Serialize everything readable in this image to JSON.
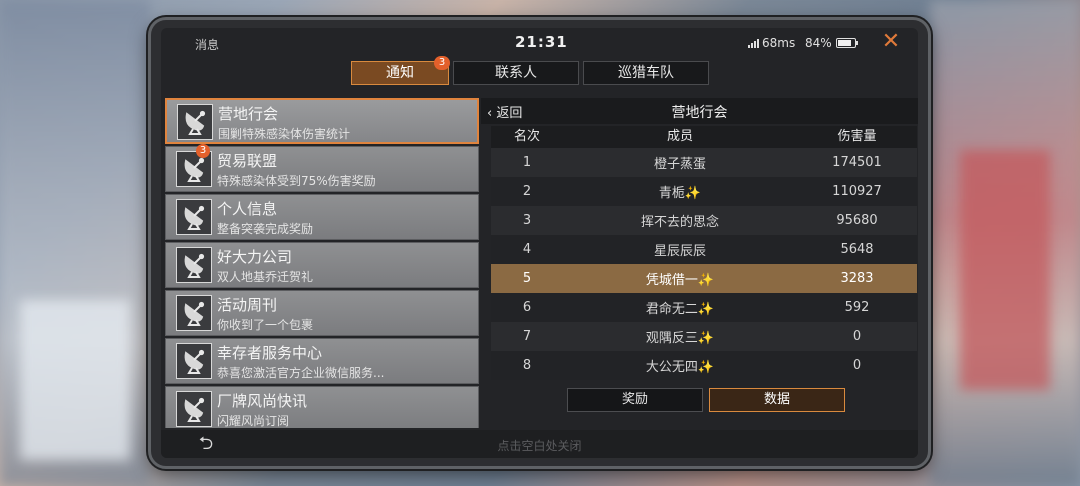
{
  "status": {
    "app_name": "消息",
    "time": "21:31",
    "signal_text": "68ms",
    "battery_text": "84%",
    "battery_level": 0.84
  },
  "tabs": [
    {
      "label": "通知",
      "badge": "3",
      "active": true
    },
    {
      "label": "联系人"
    },
    {
      "label": "巡猎车队"
    }
  ],
  "messages": [
    {
      "title": "营地行会",
      "subtitle": "围剿特殊感染体伤害统计",
      "active": true
    },
    {
      "title": "贸易联盟",
      "subtitle": "特殊感染体受到75%伤害奖励",
      "badge": "3"
    },
    {
      "title": "个人信息",
      "subtitle": "整备突袭完成奖励"
    },
    {
      "title": "好大力公司",
      "subtitle": "双人地基乔迁贺礼"
    },
    {
      "title": "活动周刊",
      "subtitle": "你收到了一个包裹"
    },
    {
      "title": "幸存者服务中心",
      "subtitle": "恭喜您激活官方企业微信服务..."
    },
    {
      "title": "厂牌风尚快讯",
      "subtitle": "闪耀风尚订阅"
    }
  ],
  "detail": {
    "back_label": "返回",
    "title": "营地行会",
    "columns": {
      "rank": "名次",
      "member": "成员",
      "damage": "伤害量"
    },
    "rows": [
      {
        "rank": "1",
        "member": "橙子蒸蛋",
        "damage": "174501"
      },
      {
        "rank": "2",
        "member": "青栀✨",
        "damage": "110927"
      },
      {
        "rank": "3",
        "member": "挥不去的思念",
        "damage": "95680"
      },
      {
        "rank": "4",
        "member": "星辰辰辰",
        "damage": "5648"
      },
      {
        "rank": "5",
        "member": "凭城借一✨",
        "damage": "3283",
        "highlight": true
      },
      {
        "rank": "6",
        "member": "君命无二✨",
        "damage": "592"
      },
      {
        "rank": "7",
        "member": "观隅反三✨",
        "damage": "0"
      },
      {
        "rank": "8",
        "member": "大公无四✨",
        "damage": "0"
      }
    ],
    "buttons": {
      "reward": "奖励",
      "data": "数据"
    }
  },
  "bottom": {
    "hint": "点击空白处关闭"
  },
  "colors": {
    "accent": "#d98a3e",
    "badge": "#e3602b",
    "highlight_row": "#8b6a43"
  }
}
